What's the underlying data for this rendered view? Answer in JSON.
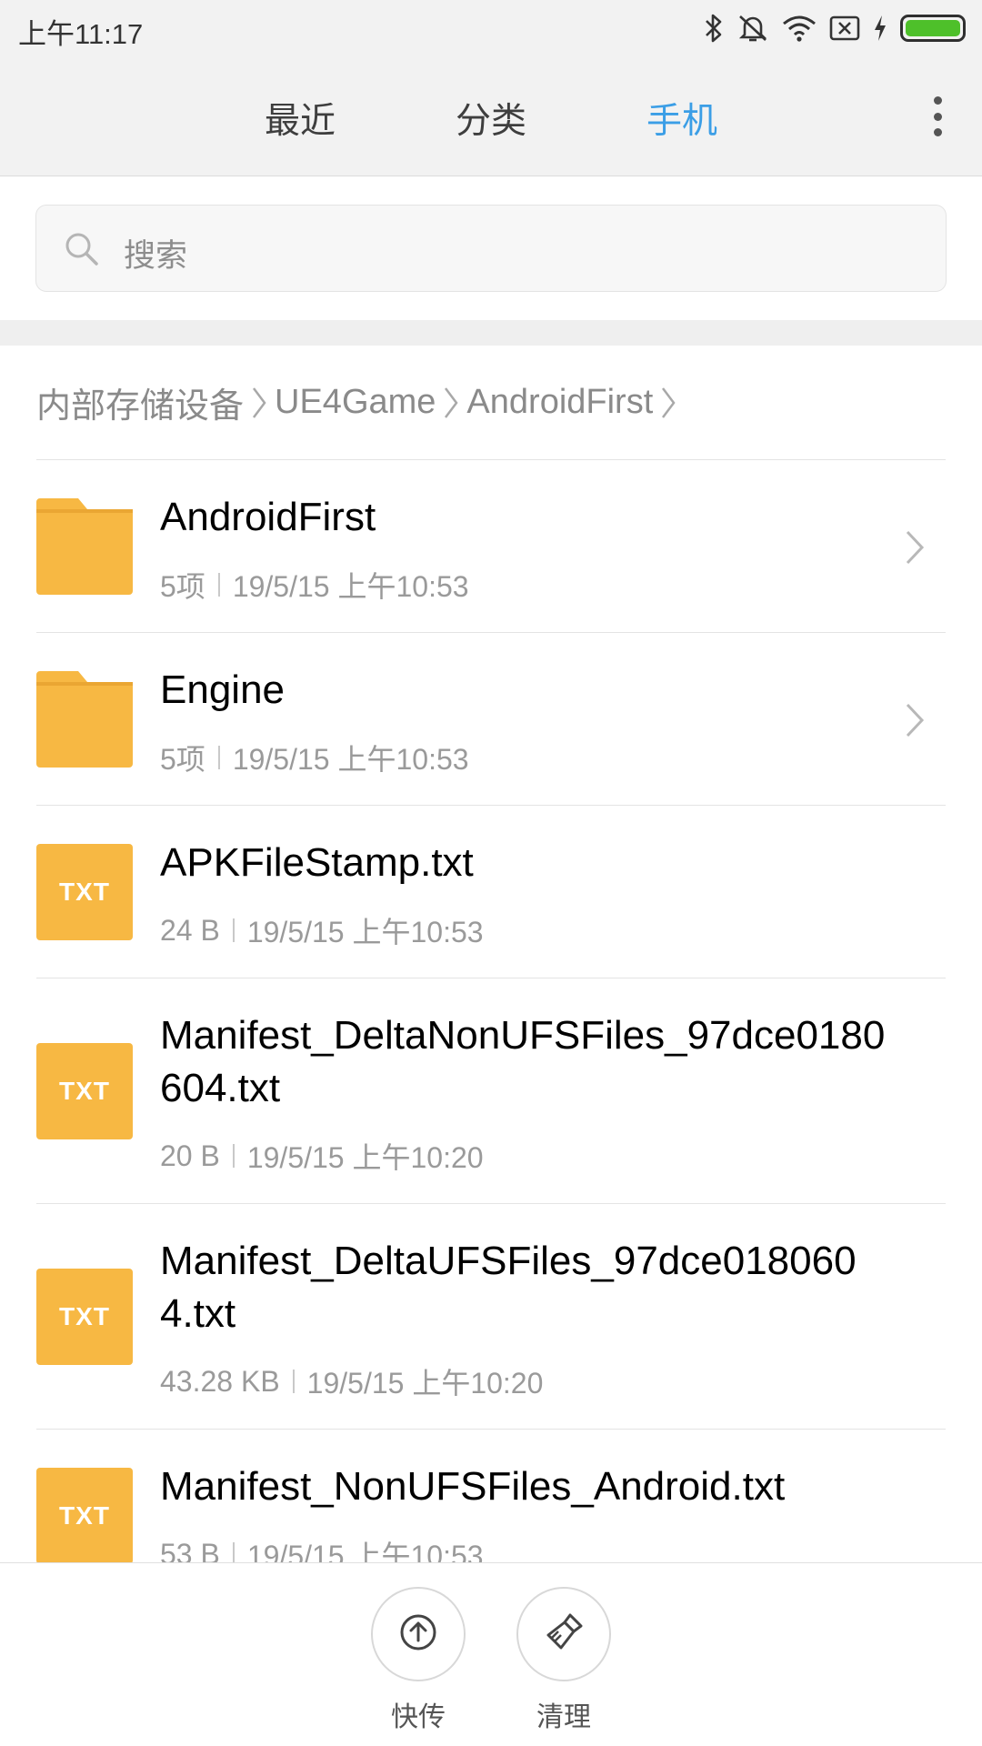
{
  "status_bar": {
    "time": "上午11:17",
    "icons": [
      "bluetooth-icon",
      "mute-icon",
      "wifi-icon",
      "no-sim-icon",
      "charging-icon",
      "battery-icon"
    ],
    "battery_color": "#4ec02a"
  },
  "tabs": {
    "items": [
      {
        "label": "最近",
        "active": false
      },
      {
        "label": "分类",
        "active": false
      },
      {
        "label": "手机",
        "active": true
      }
    ],
    "active_color": "#3b9ee6"
  },
  "search": {
    "placeholder": "搜索"
  },
  "breadcrumb": {
    "items": [
      "内部存储设备",
      "UE4Game",
      "AndroidFirst"
    ]
  },
  "files": [
    {
      "name": "AndroidFirst",
      "type": "folder",
      "info": "5项",
      "date": "19/5/15 上午10:53"
    },
    {
      "name": "Engine",
      "type": "folder",
      "info": "5项",
      "date": "19/5/15 上午10:53"
    },
    {
      "name": "APKFileStamp.txt",
      "type": "txt",
      "info": "24 B",
      "date": "19/5/15 上午10:53"
    },
    {
      "name": "Manifest_DeltaNonUFSFiles_97dce0180604.txt",
      "type": "txt",
      "info": "20 B",
      "date": "19/5/15 上午10:20"
    },
    {
      "name": "Manifest_DeltaUFSFiles_97dce0180604.txt",
      "type": "txt",
      "info": "43.28 KB",
      "date": "19/5/15 上午10:20"
    },
    {
      "name": "Manifest_NonUFSFiles_Android.txt",
      "type": "txt",
      "info": "53 B",
      "date": "19/5/15 上午10:53"
    }
  ],
  "file_icon_label": "TXT",
  "folder_color": "#f7b843",
  "bottom_actions": [
    {
      "label": "快传",
      "icon": "upload-icon"
    },
    {
      "label": "清理",
      "icon": "broom-icon"
    }
  ]
}
